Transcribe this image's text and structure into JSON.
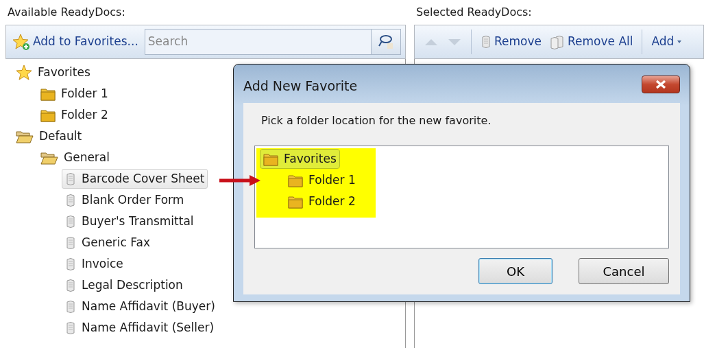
{
  "left_panel": {
    "title": "Available ReadyDocs:",
    "add_button": "Add to Favorites...",
    "search": {
      "placeholder": "Search"
    },
    "tree": [
      {
        "kind": "star",
        "label": "Favorites",
        "selected": false,
        "children": [
          {
            "kind": "folder",
            "label": "Folder 1",
            "selected": false
          },
          {
            "kind": "folder",
            "label": "Folder 2",
            "selected": false
          }
        ]
      },
      {
        "kind": "folder-open",
        "label": "Default",
        "selected": false,
        "children": [
          {
            "kind": "folder-open",
            "label": "General",
            "selected": false,
            "children": [
              {
                "kind": "doc",
                "label": "Barcode Cover Sheet",
                "selected": true
              },
              {
                "kind": "doc",
                "label": "Blank Order Form",
                "selected": false
              },
              {
                "kind": "doc",
                "label": "Buyer's Transmittal",
                "selected": false
              },
              {
                "kind": "doc",
                "label": "Generic Fax",
                "selected": false
              },
              {
                "kind": "doc",
                "label": "Invoice",
                "selected": false
              },
              {
                "kind": "doc",
                "label": "Legal Description",
                "selected": false
              },
              {
                "kind": "doc",
                "label": "Name Affidavit (Buyer)",
                "selected": false
              },
              {
                "kind": "doc",
                "label": "Name Affidavit (Seller)",
                "selected": false
              }
            ]
          }
        ]
      }
    ]
  },
  "right_panel": {
    "title": "Selected ReadyDocs:",
    "toolbar": [
      {
        "kind": "up",
        "disabled": true
      },
      {
        "kind": "down",
        "disabled": true
      },
      {
        "kind": "sep"
      },
      {
        "kind": "remove",
        "label": "Remove"
      },
      {
        "kind": "remove-all",
        "label": "Remove All"
      },
      {
        "kind": "sep"
      },
      {
        "kind": "add",
        "label": "Add"
      }
    ]
  },
  "dialog": {
    "title": "Add New Favorite",
    "prompt": "Pick a folder location for the new favorite.",
    "tree": [
      {
        "kind": "folder",
        "label": "Favorites",
        "selected": true,
        "children": [
          {
            "kind": "folder",
            "label": "Folder 1",
            "selected": false
          },
          {
            "kind": "folder",
            "label": "Folder 2",
            "selected": false
          }
        ]
      }
    ],
    "buttons": [
      {
        "label": "OK",
        "default": true
      },
      {
        "label": "Cancel",
        "default": false
      }
    ]
  }
}
